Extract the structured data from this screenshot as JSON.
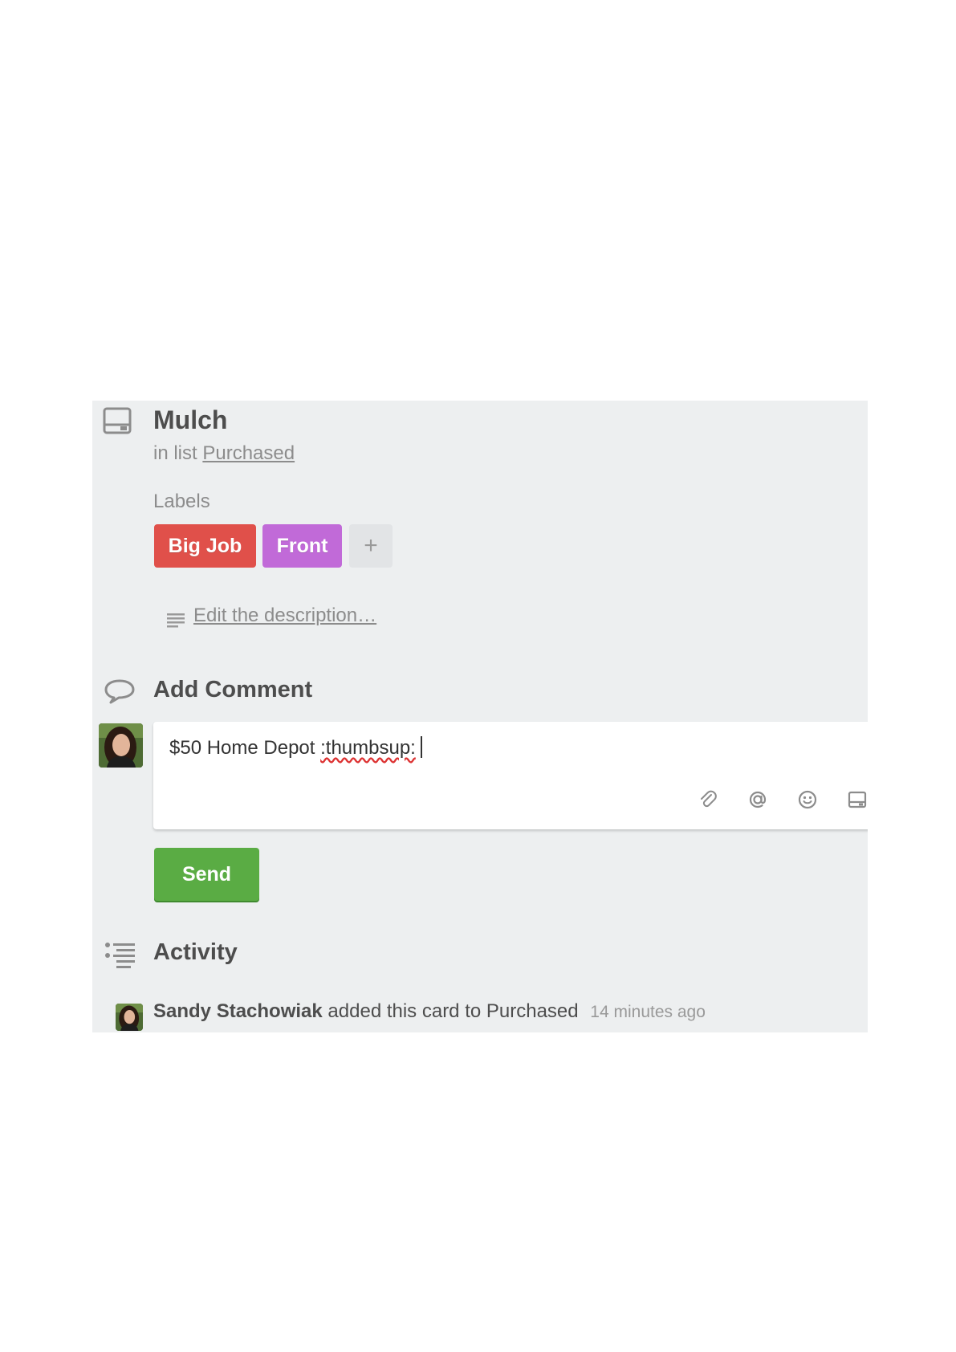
{
  "card": {
    "title": "Mulch",
    "in_list_prefix": "in list",
    "list_name": "Purchased"
  },
  "labels": {
    "heading": "Labels",
    "items": [
      {
        "text": "Big Job",
        "color": "#e0504a"
      },
      {
        "text": "Front",
        "color": "#c16ad8"
      }
    ],
    "add_label": "+"
  },
  "description": {
    "edit_link": "Edit the description…"
  },
  "comment": {
    "heading": "Add Comment",
    "value_plain": "$50 Home Depot ",
    "value_emoji": ":thumbsup:",
    "send_label": "Send",
    "send_color": "#5aac44",
    "tools": [
      "paperclip-icon",
      "mention-icon",
      "emoji-icon",
      "card-icon"
    ]
  },
  "activity": {
    "heading": "Activity",
    "entries": [
      {
        "member": "Sandy Stachowiak",
        "action": "added this card to Purchased",
        "time": "14 minutes ago"
      }
    ]
  }
}
